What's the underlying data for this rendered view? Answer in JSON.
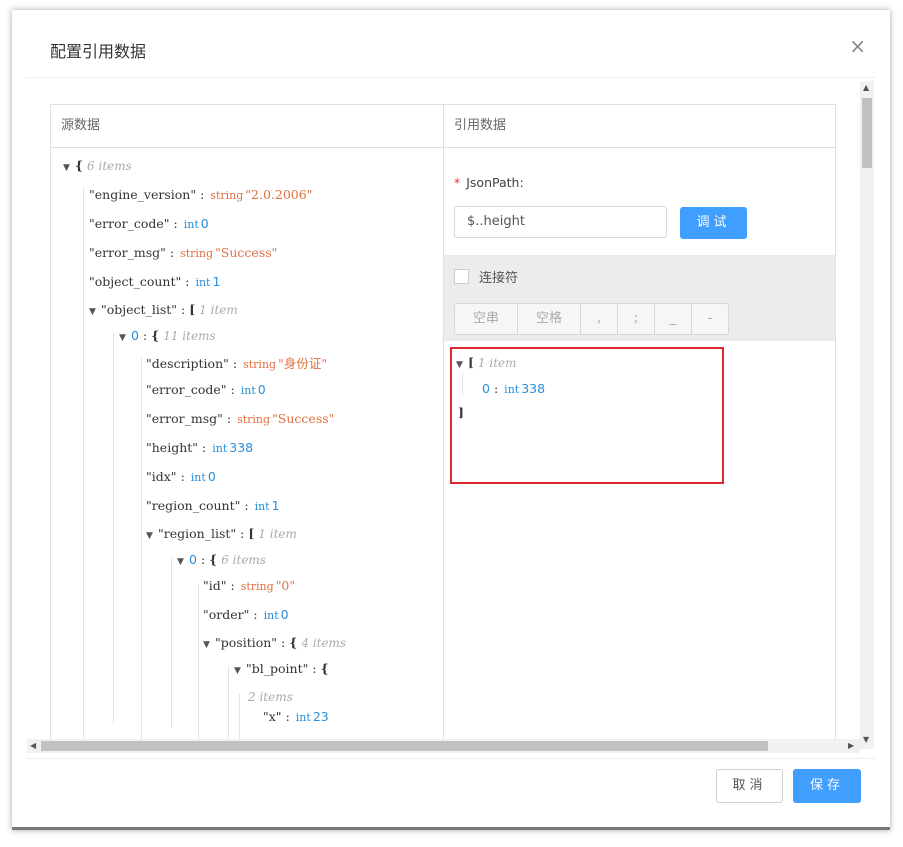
{
  "dialog": {
    "title": "配置引用数据",
    "close_icon": "×"
  },
  "left_pane": {
    "header": "源数据",
    "tree": [
      {
        "kind": "open",
        "caret": "▼",
        "brace": "{",
        "count": "6 items"
      },
      {
        "kind": "pair",
        "key": "\"engine_version\"",
        "type": "string",
        "value": "\"2.0.2006\""
      },
      {
        "kind": "pair",
        "key": "\"error_code\"",
        "type": "int",
        "value": "0"
      },
      {
        "kind": "pair",
        "key": "\"error_msg\"",
        "type": "string",
        "value": "\"Success\""
      },
      {
        "kind": "pair",
        "key": "\"object_count\"",
        "type": "int",
        "value": "1"
      },
      {
        "kind": "openkey",
        "caret": "▼",
        "key": "\"object_list\"",
        "brace": "[",
        "count": "1 item"
      },
      {
        "kind": "openidx",
        "caret": "▼",
        "idx": "0",
        "brace": "{",
        "count": "11 items"
      },
      {
        "kind": "pair",
        "key": "\"description\"",
        "type": "string",
        "value": "\"身份证\""
      },
      {
        "kind": "pair",
        "key": "\"error_code\"",
        "type": "int",
        "value": "0"
      },
      {
        "kind": "pair",
        "key": "\"error_msg\"",
        "type": "string",
        "value": "\"Success\""
      },
      {
        "kind": "pair",
        "key": "\"height\"",
        "type": "int",
        "value": "338"
      },
      {
        "kind": "pair",
        "key": "\"idx\"",
        "type": "int",
        "value": "0"
      },
      {
        "kind": "pair",
        "key": "\"region_count\"",
        "type": "int",
        "value": "1"
      },
      {
        "kind": "openkey",
        "caret": "▼",
        "key": "\"region_list\"",
        "brace": "[",
        "count": "1 item"
      },
      {
        "kind": "openidx",
        "caret": "▼",
        "idx": "0",
        "brace": "{",
        "count": "6 items"
      },
      {
        "kind": "pair",
        "key": "\"id\"",
        "type": "string",
        "value": "\"0\""
      },
      {
        "kind": "pair",
        "key": "\"order\"",
        "type": "int",
        "value": "0"
      },
      {
        "kind": "openkey",
        "caret": "▼",
        "key": "\"position\"",
        "brace": "{",
        "count": "4 items"
      },
      {
        "kind": "openkey",
        "caret": "▼",
        "key": "\"bl_point\"",
        "brace": "{",
        "count": ""
      },
      {
        "kind": "countonly",
        "count": "2 items"
      },
      {
        "kind": "pair",
        "key": "\"x\"",
        "type": "int",
        "value": "23"
      }
    ]
  },
  "right_pane": {
    "header": "引用数据",
    "jsonpath_required_mark": "*",
    "jsonpath_label": "JsonPath:",
    "jsonpath_value": "$..height",
    "debug_button": "调试",
    "connector_label": "连接符",
    "connectors": [
      "空串",
      "空格",
      ",",
      ";",
      "_",
      "-"
    ],
    "result": {
      "caret": "▼",
      "open": "[",
      "count": "1 item",
      "idx": "0",
      "type": "int",
      "value": "338",
      "close": "]"
    }
  },
  "footer": {
    "cancel": "取消",
    "save": "保存"
  }
}
